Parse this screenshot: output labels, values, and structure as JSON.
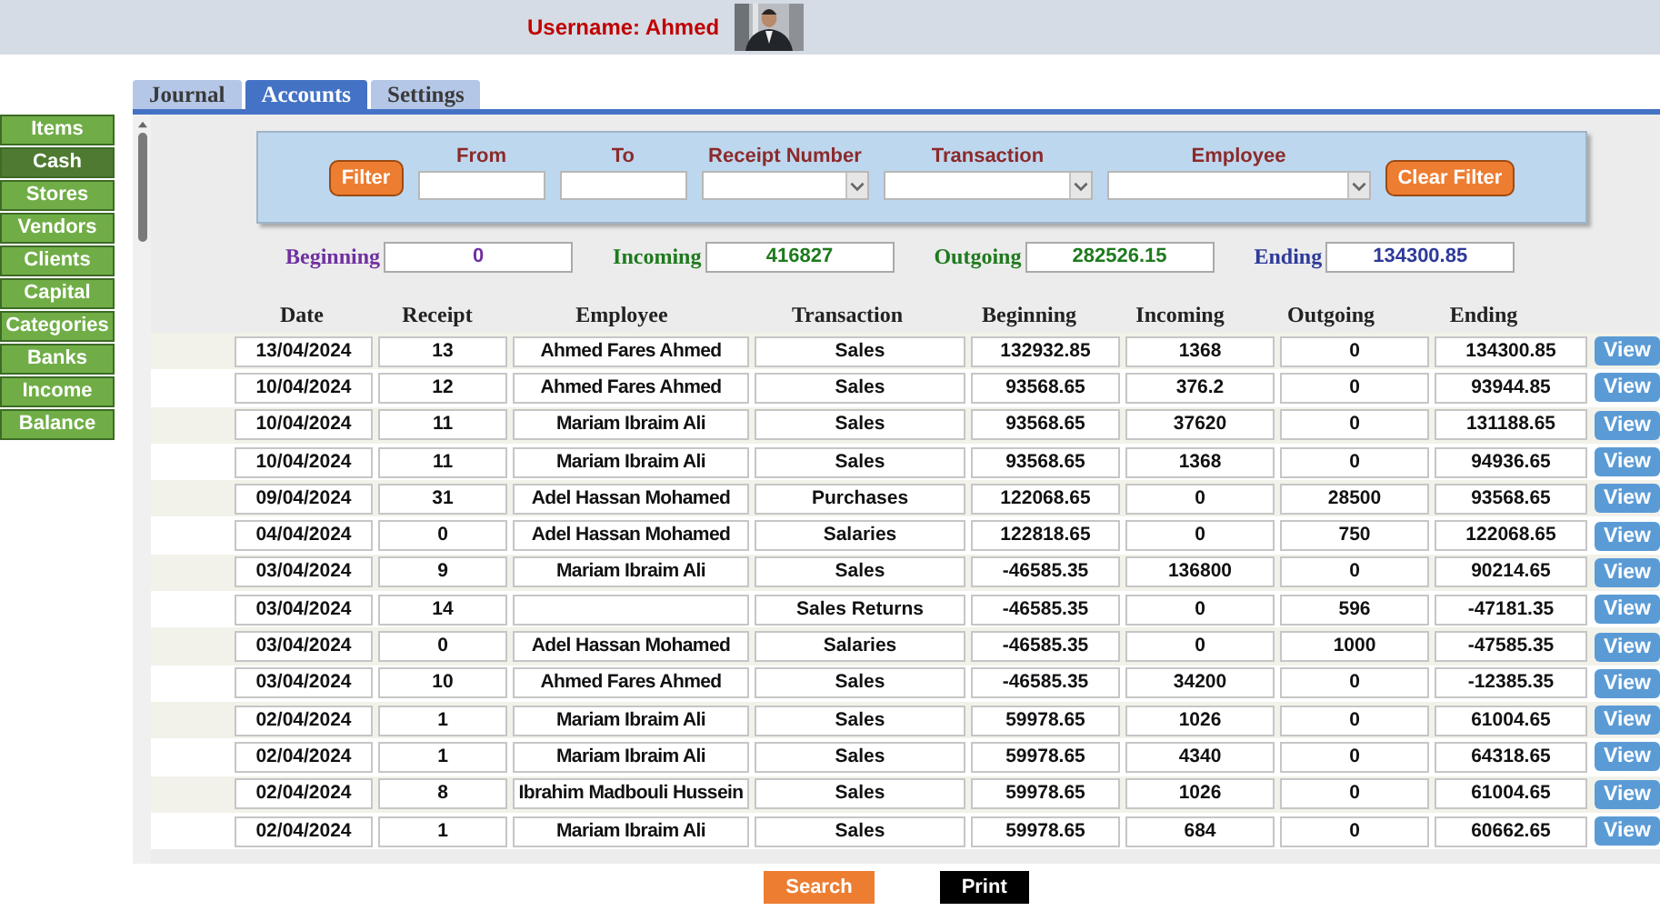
{
  "header": {
    "username": "Username: Ahmed"
  },
  "sidebar": {
    "items": [
      {
        "label": "Items",
        "selected": false
      },
      {
        "label": "Cash",
        "selected": true
      },
      {
        "label": "Stores",
        "selected": false
      },
      {
        "label": "Vendors",
        "selected": false
      },
      {
        "label": "Clients",
        "selected": false
      },
      {
        "label": "Capital",
        "selected": false
      },
      {
        "label": "Categories",
        "selected": false
      },
      {
        "label": "Banks",
        "selected": false
      },
      {
        "label": "Income",
        "selected": false
      },
      {
        "label": "Balance",
        "selected": false
      }
    ]
  },
  "tabs": [
    {
      "label": "Journal",
      "selected": false
    },
    {
      "label": "Accounts",
      "selected": true
    },
    {
      "label": "Settings",
      "selected": false
    }
  ],
  "filter": {
    "filter_button": "Filter",
    "clear_button": "Clear Filter",
    "fields": [
      {
        "label": "From",
        "kind": "text"
      },
      {
        "label": "To",
        "kind": "text"
      },
      {
        "label": "Receipt Number",
        "kind": "select"
      },
      {
        "label": "Transaction",
        "kind": "select"
      },
      {
        "label": "Employee",
        "kind": "select"
      }
    ]
  },
  "totals": [
    {
      "label": "Beginning",
      "value": "0",
      "color": "#7030a0"
    },
    {
      "label": "Incoming",
      "value": "416827",
      "color": "#1e7a1e"
    },
    {
      "label": "Outgoing",
      "value": "282526.15",
      "color": "#1e7a1e"
    },
    {
      "label": "Ending",
      "value": "134300.85",
      "color": "#2e3a9a"
    }
  ],
  "table": {
    "columns": [
      "Date",
      "Receipt",
      "Employee",
      "Transaction",
      "Beginning",
      "Incoming",
      "Outgoing",
      "Ending"
    ],
    "rows": [
      {
        "date": "13/04/2024",
        "receipt": "13",
        "employee": "Ahmed Fares Ahmed",
        "transaction": "Sales",
        "beginning": "132932.85",
        "incoming": "1368",
        "outgoing": "0",
        "ending": "134300.85",
        "action": "View"
      },
      {
        "date": "10/04/2024",
        "receipt": "12",
        "employee": "Ahmed Fares Ahmed",
        "transaction": "Sales",
        "beginning": "93568.65",
        "incoming": "376.2",
        "outgoing": "0",
        "ending": "93944.85",
        "action": "View"
      },
      {
        "date": "10/04/2024",
        "receipt": "11",
        "employee": "Mariam Ibraim Ali",
        "transaction": "Sales",
        "beginning": "93568.65",
        "incoming": "37620",
        "outgoing": "0",
        "ending": "131188.65",
        "action": "View"
      },
      {
        "date": "10/04/2024",
        "receipt": "11",
        "employee": "Mariam Ibraim Ali",
        "transaction": "Sales",
        "beginning": "93568.65",
        "incoming": "1368",
        "outgoing": "0",
        "ending": "94936.65",
        "action": "View"
      },
      {
        "date": "09/04/2024",
        "receipt": "31",
        "employee": "Adel Hassan Mohamed",
        "transaction": "Purchases",
        "beginning": "122068.65",
        "incoming": "0",
        "outgoing": "28500",
        "ending": "93568.65",
        "action": "View"
      },
      {
        "date": "04/04/2024",
        "receipt": "0",
        "employee": "Adel Hassan Mohamed",
        "transaction": "Salaries",
        "beginning": "122818.65",
        "incoming": "0",
        "outgoing": "750",
        "ending": "122068.65",
        "action": "View"
      },
      {
        "date": "03/04/2024",
        "receipt": "9",
        "employee": "Mariam Ibraim Ali",
        "transaction": "Sales",
        "beginning": "-46585.35",
        "incoming": "136800",
        "outgoing": "0",
        "ending": "90214.65",
        "action": "View"
      },
      {
        "date": "03/04/2024",
        "receipt": "14",
        "transaction": "Sales Returns",
        "beginning": "-46585.35",
        "incoming": "0",
        "outgoing": "596",
        "ending": "-47181.35",
        "action": "View"
      },
      {
        "date": "03/04/2024",
        "receipt": "0",
        "employee": "Adel Hassan Mohamed",
        "transaction": "Salaries",
        "beginning": "-46585.35",
        "incoming": "0",
        "outgoing": "1000",
        "ending": "-47585.35",
        "action": "View"
      },
      {
        "date": "03/04/2024",
        "receipt": "10",
        "employee": "Ahmed Fares Ahmed",
        "transaction": "Sales",
        "beginning": "-46585.35",
        "incoming": "34200",
        "outgoing": "0",
        "ending": "-12385.35",
        "action": "View"
      },
      {
        "date": "02/04/2024",
        "receipt": "1",
        "employee": "Mariam Ibraim Ali",
        "transaction": "Sales",
        "beginning": "59978.65",
        "incoming": "1026",
        "outgoing": "0",
        "ending": "61004.65",
        "action": "View"
      },
      {
        "date": "02/04/2024",
        "receipt": "1",
        "employee": "Mariam Ibraim Ali",
        "transaction": "Sales",
        "beginning": "59978.65",
        "incoming": "4340",
        "outgoing": "0",
        "ending": "64318.65",
        "action": "View"
      },
      {
        "date": "02/04/2024",
        "receipt": "8",
        "employee": "Ibrahim Madbouli Hussein",
        "transaction": "Sales",
        "beginning": "59978.65",
        "incoming": "1026",
        "outgoing": "0",
        "ending": "61004.65",
        "action": "View"
      },
      {
        "date": "02/04/2024",
        "receipt": "1",
        "employee": "Mariam Ibraim Ali",
        "transaction": "Sales",
        "beginning": "59978.65",
        "incoming": "684",
        "outgoing": "0",
        "ending": "60662.65",
        "action": "View"
      }
    ]
  },
  "footer": {
    "buttons": [
      {
        "label": "Search",
        "kind": "search"
      },
      {
        "label": "Print",
        "kind": "print"
      }
    ]
  }
}
